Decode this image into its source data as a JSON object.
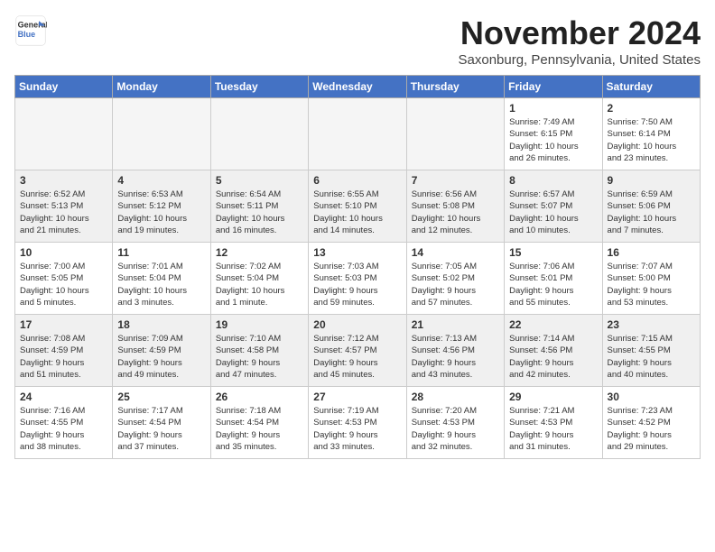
{
  "logo": {
    "line1": "General",
    "line2": "Blue"
  },
  "title": "November 2024",
  "location": "Saxonburg, Pennsylvania, United States",
  "headers": [
    "Sunday",
    "Monday",
    "Tuesday",
    "Wednesday",
    "Thursday",
    "Friday",
    "Saturday"
  ],
  "weeks": [
    [
      {
        "day": "",
        "info": ""
      },
      {
        "day": "",
        "info": ""
      },
      {
        "day": "",
        "info": ""
      },
      {
        "day": "",
        "info": ""
      },
      {
        "day": "",
        "info": ""
      },
      {
        "day": "1",
        "info": "Sunrise: 7:49 AM\nSunset: 6:15 PM\nDaylight: 10 hours\nand 26 minutes."
      },
      {
        "day": "2",
        "info": "Sunrise: 7:50 AM\nSunset: 6:14 PM\nDaylight: 10 hours\nand 23 minutes."
      }
    ],
    [
      {
        "day": "3",
        "info": "Sunrise: 6:52 AM\nSunset: 5:13 PM\nDaylight: 10 hours\nand 21 minutes."
      },
      {
        "day": "4",
        "info": "Sunrise: 6:53 AM\nSunset: 5:12 PM\nDaylight: 10 hours\nand 19 minutes."
      },
      {
        "day": "5",
        "info": "Sunrise: 6:54 AM\nSunset: 5:11 PM\nDaylight: 10 hours\nand 16 minutes."
      },
      {
        "day": "6",
        "info": "Sunrise: 6:55 AM\nSunset: 5:10 PM\nDaylight: 10 hours\nand 14 minutes."
      },
      {
        "day": "7",
        "info": "Sunrise: 6:56 AM\nSunset: 5:08 PM\nDaylight: 10 hours\nand 12 minutes."
      },
      {
        "day": "8",
        "info": "Sunrise: 6:57 AM\nSunset: 5:07 PM\nDaylight: 10 hours\nand 10 minutes."
      },
      {
        "day": "9",
        "info": "Sunrise: 6:59 AM\nSunset: 5:06 PM\nDaylight: 10 hours\nand 7 minutes."
      }
    ],
    [
      {
        "day": "10",
        "info": "Sunrise: 7:00 AM\nSunset: 5:05 PM\nDaylight: 10 hours\nand 5 minutes."
      },
      {
        "day": "11",
        "info": "Sunrise: 7:01 AM\nSunset: 5:04 PM\nDaylight: 10 hours\nand 3 minutes."
      },
      {
        "day": "12",
        "info": "Sunrise: 7:02 AM\nSunset: 5:04 PM\nDaylight: 10 hours\nand 1 minute."
      },
      {
        "day": "13",
        "info": "Sunrise: 7:03 AM\nSunset: 5:03 PM\nDaylight: 9 hours\nand 59 minutes."
      },
      {
        "day": "14",
        "info": "Sunrise: 7:05 AM\nSunset: 5:02 PM\nDaylight: 9 hours\nand 57 minutes."
      },
      {
        "day": "15",
        "info": "Sunrise: 7:06 AM\nSunset: 5:01 PM\nDaylight: 9 hours\nand 55 minutes."
      },
      {
        "day": "16",
        "info": "Sunrise: 7:07 AM\nSunset: 5:00 PM\nDaylight: 9 hours\nand 53 minutes."
      }
    ],
    [
      {
        "day": "17",
        "info": "Sunrise: 7:08 AM\nSunset: 4:59 PM\nDaylight: 9 hours\nand 51 minutes."
      },
      {
        "day": "18",
        "info": "Sunrise: 7:09 AM\nSunset: 4:59 PM\nDaylight: 9 hours\nand 49 minutes."
      },
      {
        "day": "19",
        "info": "Sunrise: 7:10 AM\nSunset: 4:58 PM\nDaylight: 9 hours\nand 47 minutes."
      },
      {
        "day": "20",
        "info": "Sunrise: 7:12 AM\nSunset: 4:57 PM\nDaylight: 9 hours\nand 45 minutes."
      },
      {
        "day": "21",
        "info": "Sunrise: 7:13 AM\nSunset: 4:56 PM\nDaylight: 9 hours\nand 43 minutes."
      },
      {
        "day": "22",
        "info": "Sunrise: 7:14 AM\nSunset: 4:56 PM\nDaylight: 9 hours\nand 42 minutes."
      },
      {
        "day": "23",
        "info": "Sunrise: 7:15 AM\nSunset: 4:55 PM\nDaylight: 9 hours\nand 40 minutes."
      }
    ],
    [
      {
        "day": "24",
        "info": "Sunrise: 7:16 AM\nSunset: 4:55 PM\nDaylight: 9 hours\nand 38 minutes."
      },
      {
        "day": "25",
        "info": "Sunrise: 7:17 AM\nSunset: 4:54 PM\nDaylight: 9 hours\nand 37 minutes."
      },
      {
        "day": "26",
        "info": "Sunrise: 7:18 AM\nSunset: 4:54 PM\nDaylight: 9 hours\nand 35 minutes."
      },
      {
        "day": "27",
        "info": "Sunrise: 7:19 AM\nSunset: 4:53 PM\nDaylight: 9 hours\nand 33 minutes."
      },
      {
        "day": "28",
        "info": "Sunrise: 7:20 AM\nSunset: 4:53 PM\nDaylight: 9 hours\nand 32 minutes."
      },
      {
        "day": "29",
        "info": "Sunrise: 7:21 AM\nSunset: 4:53 PM\nDaylight: 9 hours\nand 31 minutes."
      },
      {
        "day": "30",
        "info": "Sunrise: 7:23 AM\nSunset: 4:52 PM\nDaylight: 9 hours\nand 29 minutes."
      }
    ]
  ]
}
